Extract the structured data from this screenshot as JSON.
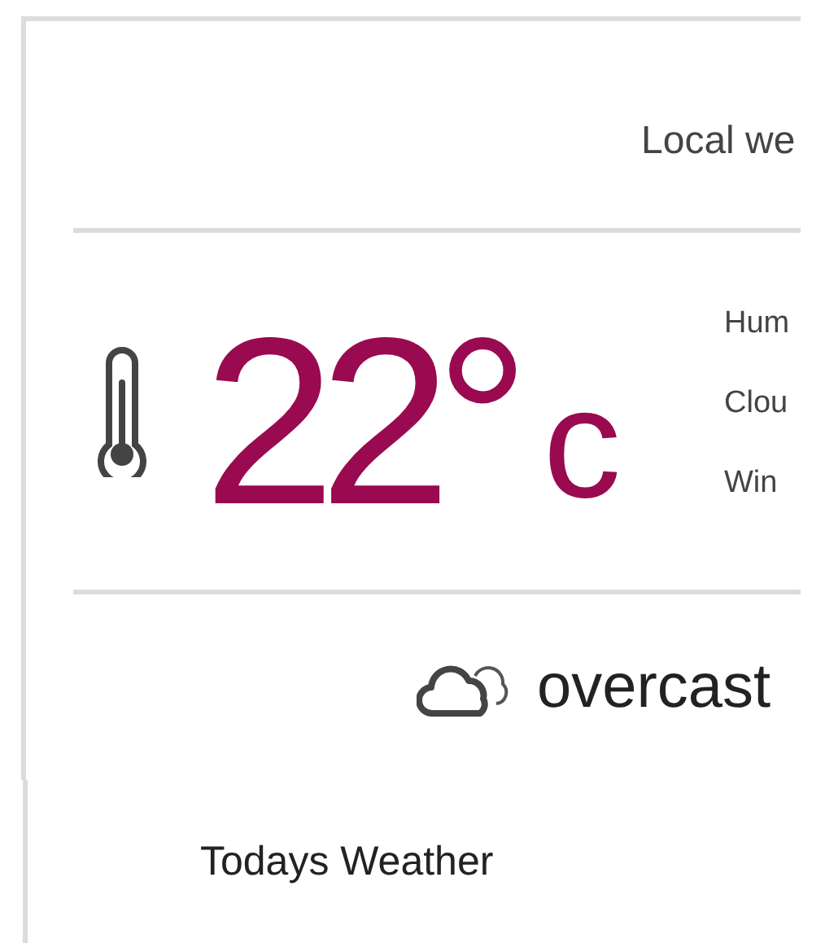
{
  "header": {
    "title": "Local we"
  },
  "temperature": {
    "value": "22°",
    "unit": "c"
  },
  "details": [
    "Hum",
    "Clou",
    "Win"
  ],
  "condition": {
    "text": "overcast"
  },
  "section": {
    "title": "Todays Weather"
  }
}
